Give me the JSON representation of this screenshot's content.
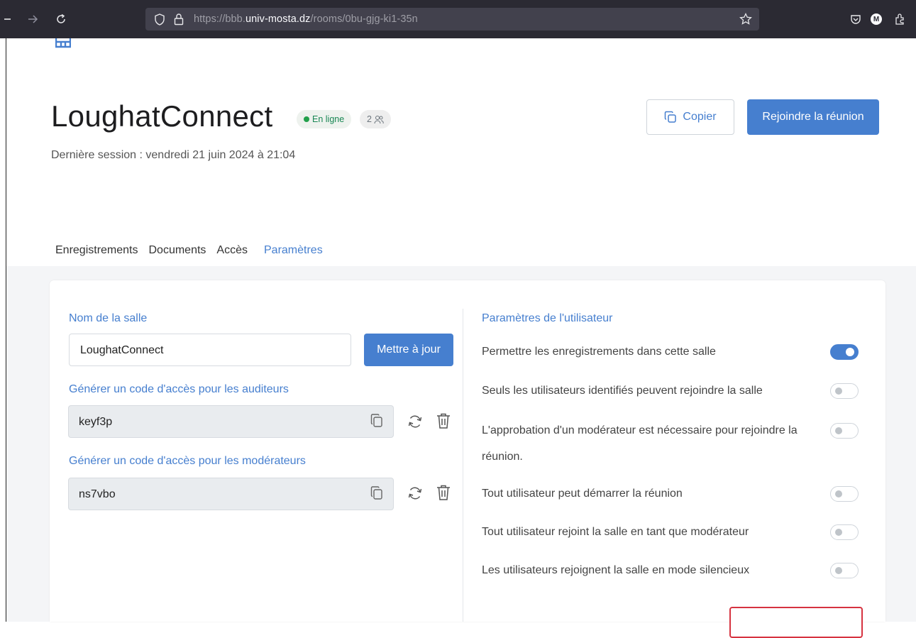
{
  "browser": {
    "url_prefix": "https://bbb.",
    "url_domain": "univ-mosta.dz",
    "url_path": "/rooms/0bu-gjg-ki1-35n",
    "profile_initial": "M"
  },
  "room": {
    "title": "LoughatConnect",
    "status": "En ligne",
    "participants_count": "2",
    "last_session": "Dernière session : vendredi 21 juin 2024 à 21:04"
  },
  "actions": {
    "copy_label": "Copier",
    "join_label": "Rejoindre la réunion"
  },
  "tabs": [
    {
      "label": "Enregistrements"
    },
    {
      "label": "Documents"
    },
    {
      "label": "Accès"
    },
    {
      "label": "Paramètres"
    }
  ],
  "left_panel": {
    "room_name_label": "Nom de la salle",
    "room_name_value": "LoughatConnect",
    "update_label": "Mettre à jour",
    "viewer_code_label": "Générer un code d'accès pour les auditeurs",
    "viewer_code": "keyf3p",
    "moderator_code_label": "Générer un code d'accès pour les modérateurs",
    "moderator_code": "ns7vbo"
  },
  "right_panel": {
    "title": "Paramètres de l'utilisateur",
    "settings": [
      {
        "label": "Permettre les enregistrements dans cette salle",
        "enabled": true
      },
      {
        "label": "Seuls les utilisateurs identifiés peuvent rejoindre la salle",
        "enabled": false
      },
      {
        "label": "L'approbation d'un modérateur est nécessaire pour rejoindre la",
        "label_line2": "réunion.",
        "enabled": false
      },
      {
        "label": "Tout utilisateur peut démarrer la réunion",
        "enabled": false
      },
      {
        "label": "Tout utilisateur rejoint la salle en tant que modérateur",
        "enabled": false
      },
      {
        "label": "Les utilisateurs rejoignent la salle en mode silencieux",
        "enabled": false
      }
    ]
  },
  "colors": {
    "accent": "#467fcf",
    "online": "#22a04b",
    "danger": "#d63340"
  }
}
